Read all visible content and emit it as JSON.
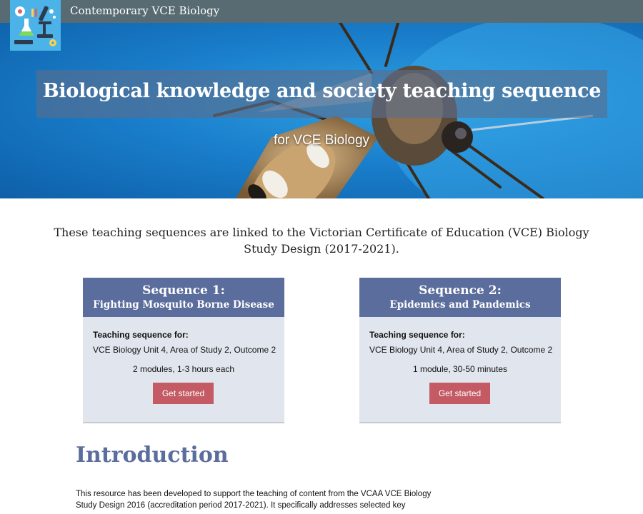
{
  "site": {
    "title": "Contemporary VCE Biology"
  },
  "hero": {
    "title": "Biological knowledge and society teaching sequence",
    "subtitle": "for VCE Biology"
  },
  "lead": "These teaching sequences are linked to the Victorian Certificate of Education (VCE) Biology Study Design (2017-2021).",
  "sequences": [
    {
      "heading": "Sequence 1:",
      "name": "Fighting Mosquito Borne Disease",
      "for_label": "Teaching sequence for:",
      "outcome": "VCE Biology Unit 4, Area of Study 2, Outcome 2",
      "duration": "2 modules, 1-3 hours each",
      "button": "Get started"
    },
    {
      "heading": "Sequence 2:",
      "name": "Epidemics and Pandemics",
      "for_label": "Teaching sequence for:",
      "outcome": "VCE Biology Unit 4, Area of Study 2, Outcome 2",
      "duration": "1 module, 30-50 minutes",
      "button": "Get started"
    }
  ],
  "introduction": {
    "heading": "Introduction",
    "body": "This resource has been developed to support the teaching of content from the VCAA VCE Biology Study Design 2016 (accreditation period 2017-2021). It specifically addresses selected key"
  },
  "colors": {
    "topbar": "#586b72",
    "card_header": "#5b6d9c",
    "card_body": "#e1e5ed",
    "button": "#c35a64",
    "heading": "#5b6d9c"
  },
  "icons": {
    "logo": "science-lab-logo",
    "hero_image": "mosquito-photo"
  }
}
